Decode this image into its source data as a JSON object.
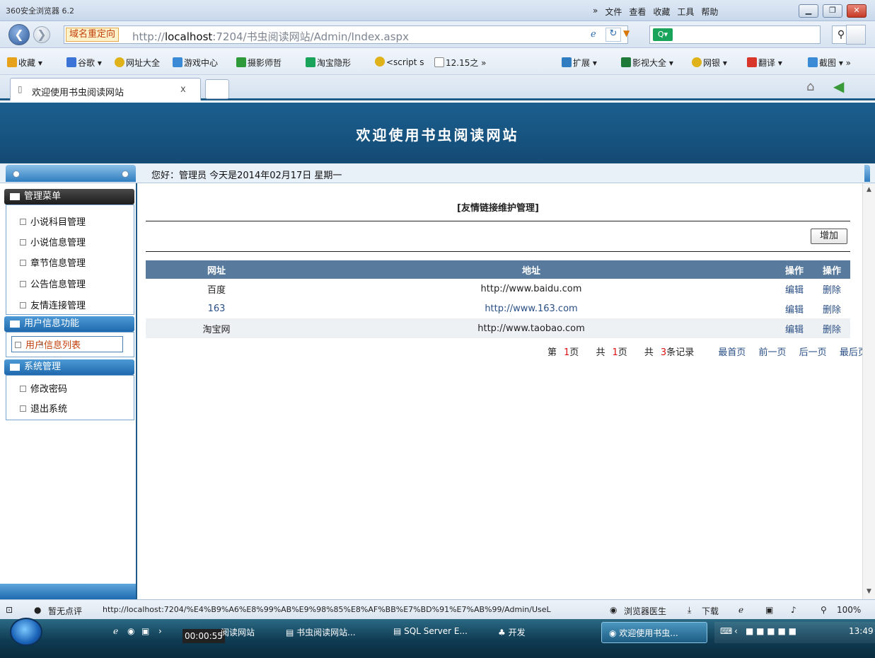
{
  "browser": {
    "app_title": "360安全浏览器 6.2",
    "menus": [
      "»",
      "文件",
      "查看",
      "收藏",
      "工具",
      "帮助"
    ],
    "address": {
      "redirect_tag": "域名重定向",
      "url_prefix": "http://",
      "url_host": "localhost",
      "url_rest": ":7204/书虫阅读网站/Admin/Index.aspx"
    },
    "favorites": [
      {
        "label": "收藏 ▾",
        "color": "#e6a21a"
      },
      {
        "label": "谷歌 ▾",
        "color": "#3b73d6"
      },
      {
        "label": "网址大全",
        "color": "#e0b21a"
      },
      {
        "label": "游戏中心",
        "color": "#3a8ad6"
      },
      {
        "label": "摄影师哲",
        "color": "#2f9a3a"
      },
      {
        "label": "淘宝隐形",
        "color": "#19a35b"
      },
      {
        "label": "<script s",
        "color": "#e0b21a"
      },
      {
        "label": "12.15之 »",
        "color": "#ffffff"
      },
      {
        "label": "扩展 ▾",
        "color": "#2f7dc0"
      },
      {
        "label": "影视大全 ▾",
        "color": "#1f7a3a"
      },
      {
        "label": "网银 ▾",
        "color": "#e0b21a"
      },
      {
        "label": "翻译 ▾",
        "color": "#d9362b"
      },
      {
        "label": "截图 ▾ »",
        "color": "#3a8ad6"
      }
    ],
    "tab_label": "欢迎使用书虫阅读网站",
    "tab_close": "x"
  },
  "page": {
    "site_title": "欢迎使用书虫阅读网站",
    "greeting": "您好：管理员   今天是2014年02月17日   星期一",
    "sidebar": {
      "group1": "管理菜单",
      "group1_items": [
        "小说科目管理",
        "小说信息管理",
        "章节信息管理",
        "公告信息管理",
        "友情连接管理"
      ],
      "group2": "用户信息功能",
      "group2_items": [
        "用户信息列表"
      ],
      "group3": "系统管理",
      "group3_items": [
        "修改密码",
        "退出系统"
      ]
    },
    "main": {
      "section_title": "[友情链接维护管理]",
      "add_button": "增加",
      "columns": [
        "网址",
        "地址",
        "操作",
        "操作"
      ],
      "rows": [
        {
          "name": "百度",
          "url": "http://www.baidu.com",
          "edit": "编辑",
          "delete": "删除"
        },
        {
          "name": "163",
          "url": "http://www.163.com",
          "edit": "编辑",
          "delete": "删除"
        },
        {
          "name": "淘宝网",
          "url": "http://www.taobao.com",
          "edit": "编辑",
          "delete": "删除"
        }
      ],
      "pager": {
        "page_prefix": "第",
        "page_num": "1",
        "page_suffix": "页",
        "total_prefix": "共",
        "total_num": "1",
        "total_suffix": "页",
        "records_prefix": "共",
        "records_num": "3",
        "records_suffix": "条记录",
        "first": "最首页",
        "prev": "前一页",
        "next": "后一页",
        "last": "最后页"
      }
    }
  },
  "status": {
    "rating": "暂无点评",
    "url": "http://localhost:7204/%E4%B9%A6%E8%99%AB%E9%98%85%E8%AF%BB%E7%BD%91%E7%AB%99/Admin/UseL",
    "doctor": "浏览器医生",
    "download": "下载",
    "zoom": "100%"
  },
  "taskbar": {
    "timer": "00:00:55",
    "items": [
      "阅读网站",
      "书虫阅读网站...",
      "SQL Server E...",
      "开发",
      "欢迎使用书虫..."
    ],
    "clock": "13:49"
  }
}
